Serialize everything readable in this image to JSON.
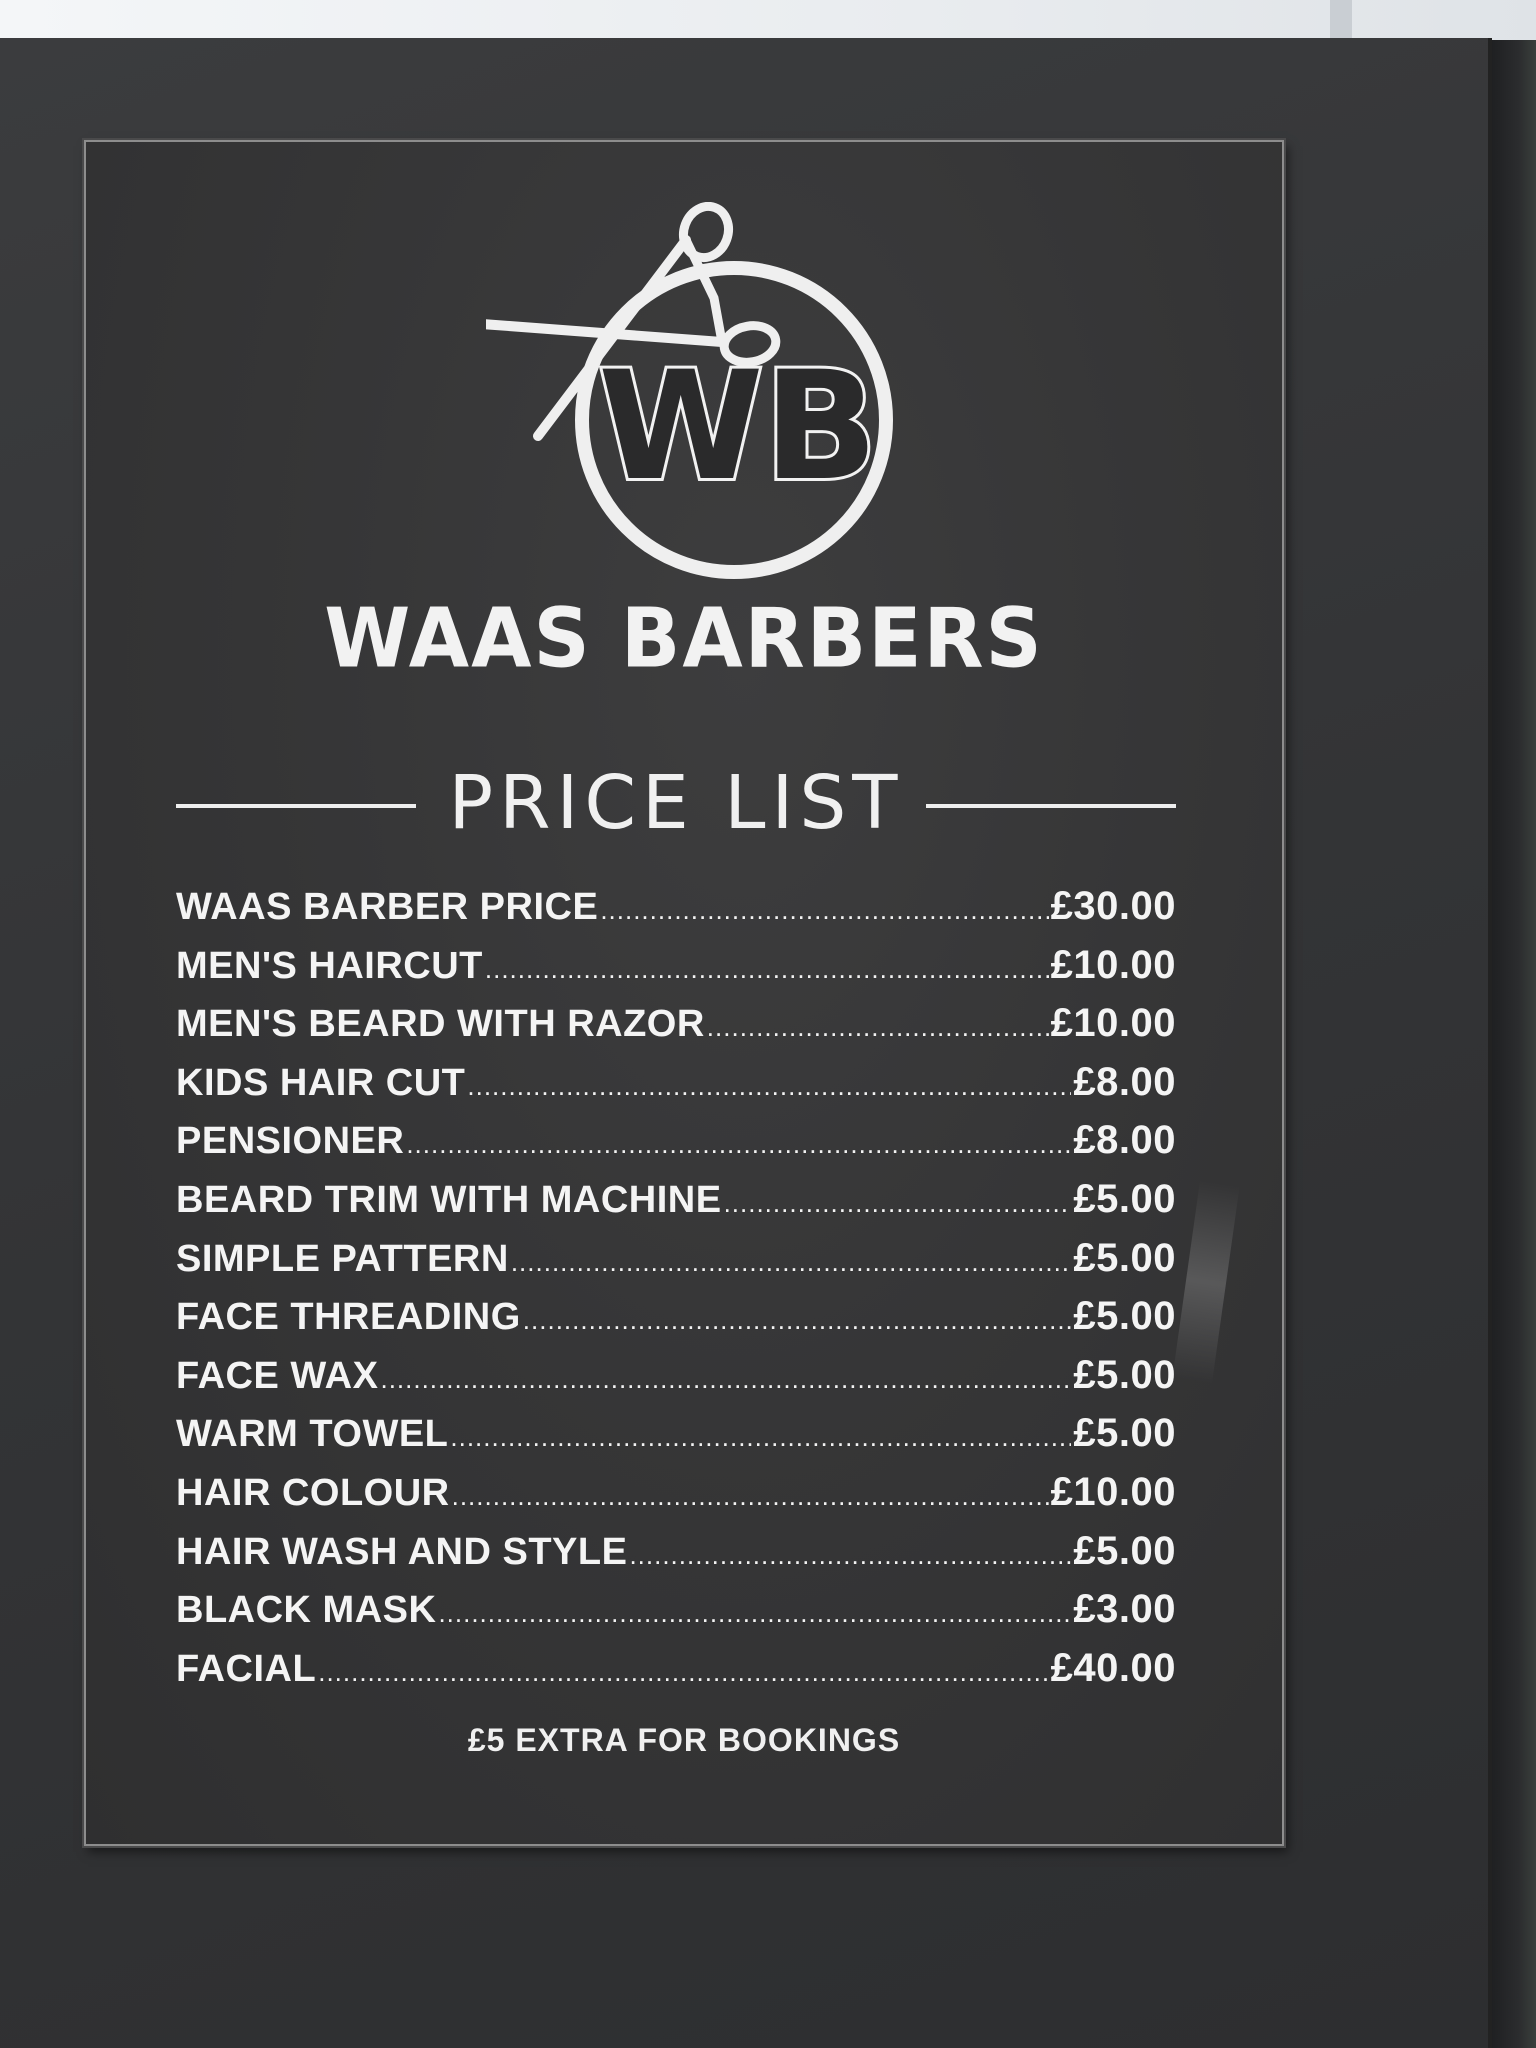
{
  "sign": {
    "logo_text": "WB",
    "shop_name": "WAAS BARBERS",
    "heading": "PRICE LIST",
    "items": [
      {
        "name": "WAAS BARBER PRICE",
        "price": "£30.00"
      },
      {
        "name": "MEN'S HAIRCUT",
        "price": "£10.00"
      },
      {
        "name": "MEN'S BEARD WITH RAZOR",
        "price": "£10.00"
      },
      {
        "name": "KIDS HAIR CUT",
        "price": "£8.00"
      },
      {
        "name": "PENSIONER",
        "price": "£8.00"
      },
      {
        "name": "BEARD TRIM WITH MACHINE",
        "price": "£5.00"
      },
      {
        "name": "SIMPLE PATTERN",
        "price": "£5.00"
      },
      {
        "name": "FACE THREADING",
        "price": "£5.00"
      },
      {
        "name": "FACE WAX",
        "price": "£5.00"
      },
      {
        "name": "WARM TOWEL",
        "price": "£5.00"
      },
      {
        "name": "HAIR COLOUR",
        "price": "£10.00"
      },
      {
        "name": "HAIR WASH AND STYLE",
        "price": "£5.00"
      },
      {
        "name": "BLACK MASK",
        "price": "£3.00"
      },
      {
        "name": "FACIAL",
        "price": "£40.00"
      }
    ],
    "footer_note": "£5 EXTRA FOR BOOKINGS"
  },
  "colors": {
    "sign_background": "#363637",
    "sign_text": "#f2f2f2",
    "backing_panel": "#333436"
  },
  "icons": [
    "scissors-icon",
    "logo-circle"
  ]
}
